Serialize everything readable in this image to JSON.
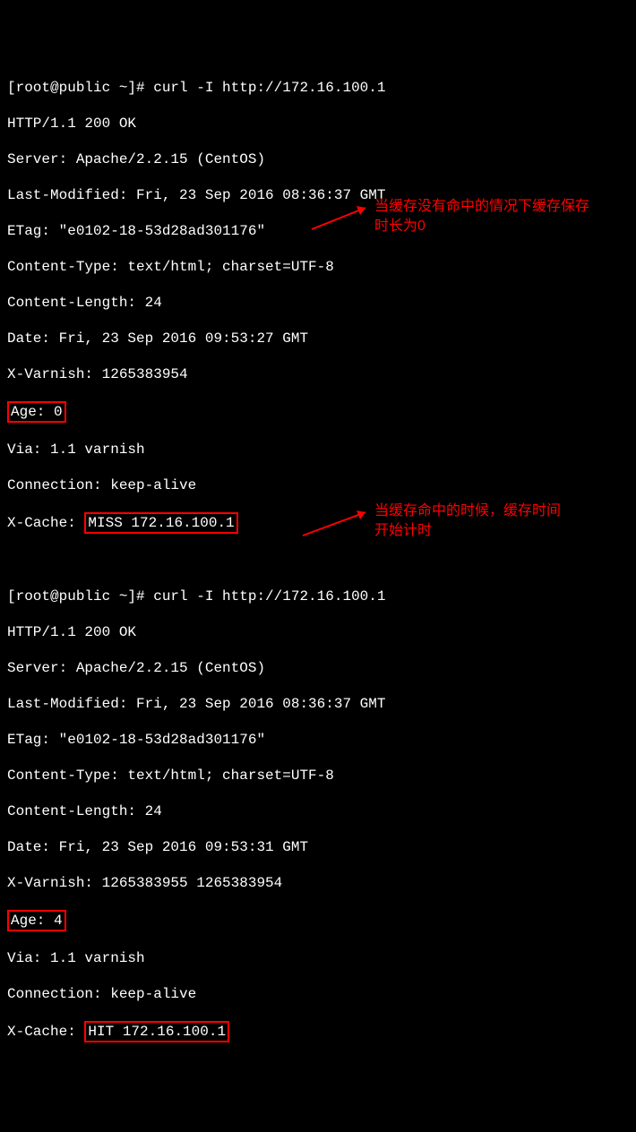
{
  "req1": {
    "prompt": "[root@public ~]# curl -I http://172.16.100.1",
    "h0": "HTTP/1.1 200 OK",
    "h1": "Server: Apache/2.2.15 (CentOS)",
    "h2": "Last-Modified: Fri, 23 Sep 2016 08:36:37 GMT",
    "h3": "ETag: \"e0102-18-53d28ad301176\"",
    "h4": "Content-Type: text/html; charset=UTF-8",
    "h5": "Content-Length: 24",
    "h6": "Date: Fri, 23 Sep 2016 09:53:27 GMT",
    "h7": "X-Varnish: 1265383954",
    "age_label": "Age: 0",
    "h8": "Via: 1.1 varnish",
    "h9": "Connection: keep-alive",
    "xc_prefix": "X-Cache: ",
    "xc_value": "MISS 172.16.100.1"
  },
  "req2": {
    "prompt": "[root@public ~]# curl -I http://172.16.100.1",
    "h0": "HTTP/1.1 200 OK",
    "h1": "Server: Apache/2.2.15 (CentOS)",
    "h2": "Last-Modified: Fri, 23 Sep 2016 08:36:37 GMT",
    "h3": "ETag: \"e0102-18-53d28ad301176\"",
    "h4": "Content-Type: text/html; charset=UTF-8",
    "h5": "Content-Length: 24",
    "h6": "Date: Fri, 23 Sep 2016 09:53:31 GMT",
    "h7": "X-Varnish: 1265383955 1265383954",
    "age_label": "Age: 4",
    "h8": "Via: 1.1 varnish",
    "h9": "Connection: keep-alive",
    "xc_prefix": "X-Cache: ",
    "xc_value": "HIT 172.16.100.1"
  },
  "anno1_l1": "当缓存没有命中的情况下缓存保存",
  "anno1_l2": "时长为0",
  "anno2_l1": "当缓存命中的时候，缓存时间",
  "anno2_l2": "开始计时"
}
